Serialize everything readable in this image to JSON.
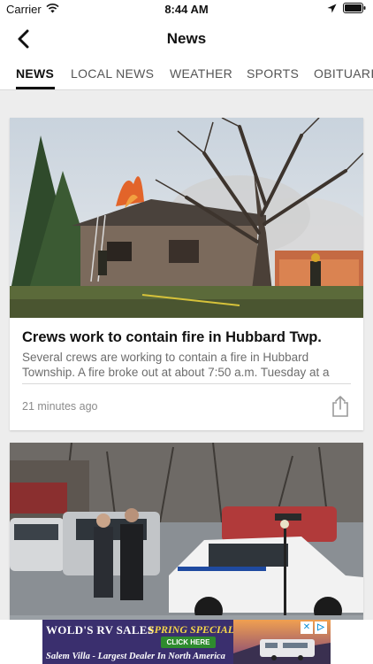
{
  "status_bar": {
    "carrier": "Carrier",
    "time": "8:44 AM"
  },
  "nav": {
    "title": "News"
  },
  "tabs": [
    {
      "label": "NEWS",
      "active": true
    },
    {
      "label": "LOCAL NEWS",
      "active": false
    },
    {
      "label": "WEATHER",
      "active": false
    },
    {
      "label": "SPORTS",
      "active": false
    },
    {
      "label": "OBITUARIES",
      "active": false
    }
  ],
  "articles": [
    {
      "headline": "Crews work to contain fire in Hubbard Twp.",
      "summary": "Several crews are working to contain a fire in Hubbard Township. A fire broke out at about 7:50 a.m. Tuesday at a",
      "timestamp": "21 minutes ago"
    }
  ],
  "ad": {
    "brand": "WOLD'S RV SALES",
    "special": "SPRING SPECIAL",
    "cta": "CLICK HERE",
    "tagline": "Salem Villa - Largest Dealer In North America",
    "close_symbol": "✕",
    "choices_symbol": "▷"
  },
  "colors": {
    "accent": "#111111",
    "background": "#ededed",
    "ad_background": "#3a2f6e",
    "ad_highlight": "#f6d64a"
  },
  "icons": [
    "wifi-icon",
    "location-arrow-icon",
    "battery-icon",
    "back-chevron-icon",
    "share-icon",
    "ad-choices-icon",
    "ad-close-icon"
  ]
}
